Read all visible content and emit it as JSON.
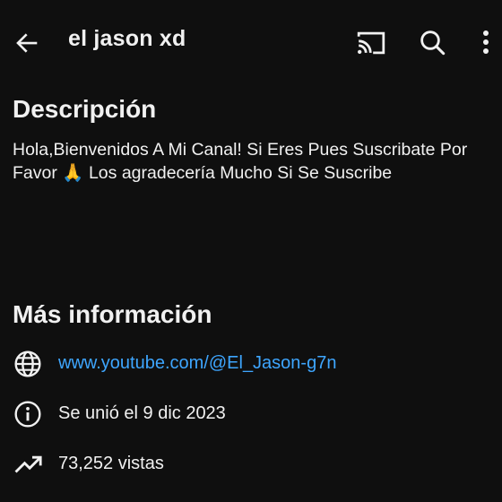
{
  "header": {
    "title": "el jason xd",
    "icons": {
      "back": "arrow-left-icon",
      "cast": "cast-icon",
      "search": "search-icon",
      "more": "more-vertical-icon"
    }
  },
  "description": {
    "heading": "Descripción",
    "text": "Hola,Bienvenidos A Mi Canal! Si Eres Pues Suscribate Por Favor 🙏 Los agradecería Mucho Si Se Suscribe"
  },
  "more_info": {
    "heading": "Más información",
    "link": "www.youtube.com/@El_Jason-g7n",
    "joined": "Se unió el 9 dic 2023",
    "views": "73,252 vistas",
    "icons": {
      "link": "globe-icon",
      "joined": "info-icon",
      "views": "trending-up-icon"
    }
  },
  "colors": {
    "background": "#0f0f0f",
    "text": "#f1f1f1",
    "link": "#3ea6ff"
  }
}
